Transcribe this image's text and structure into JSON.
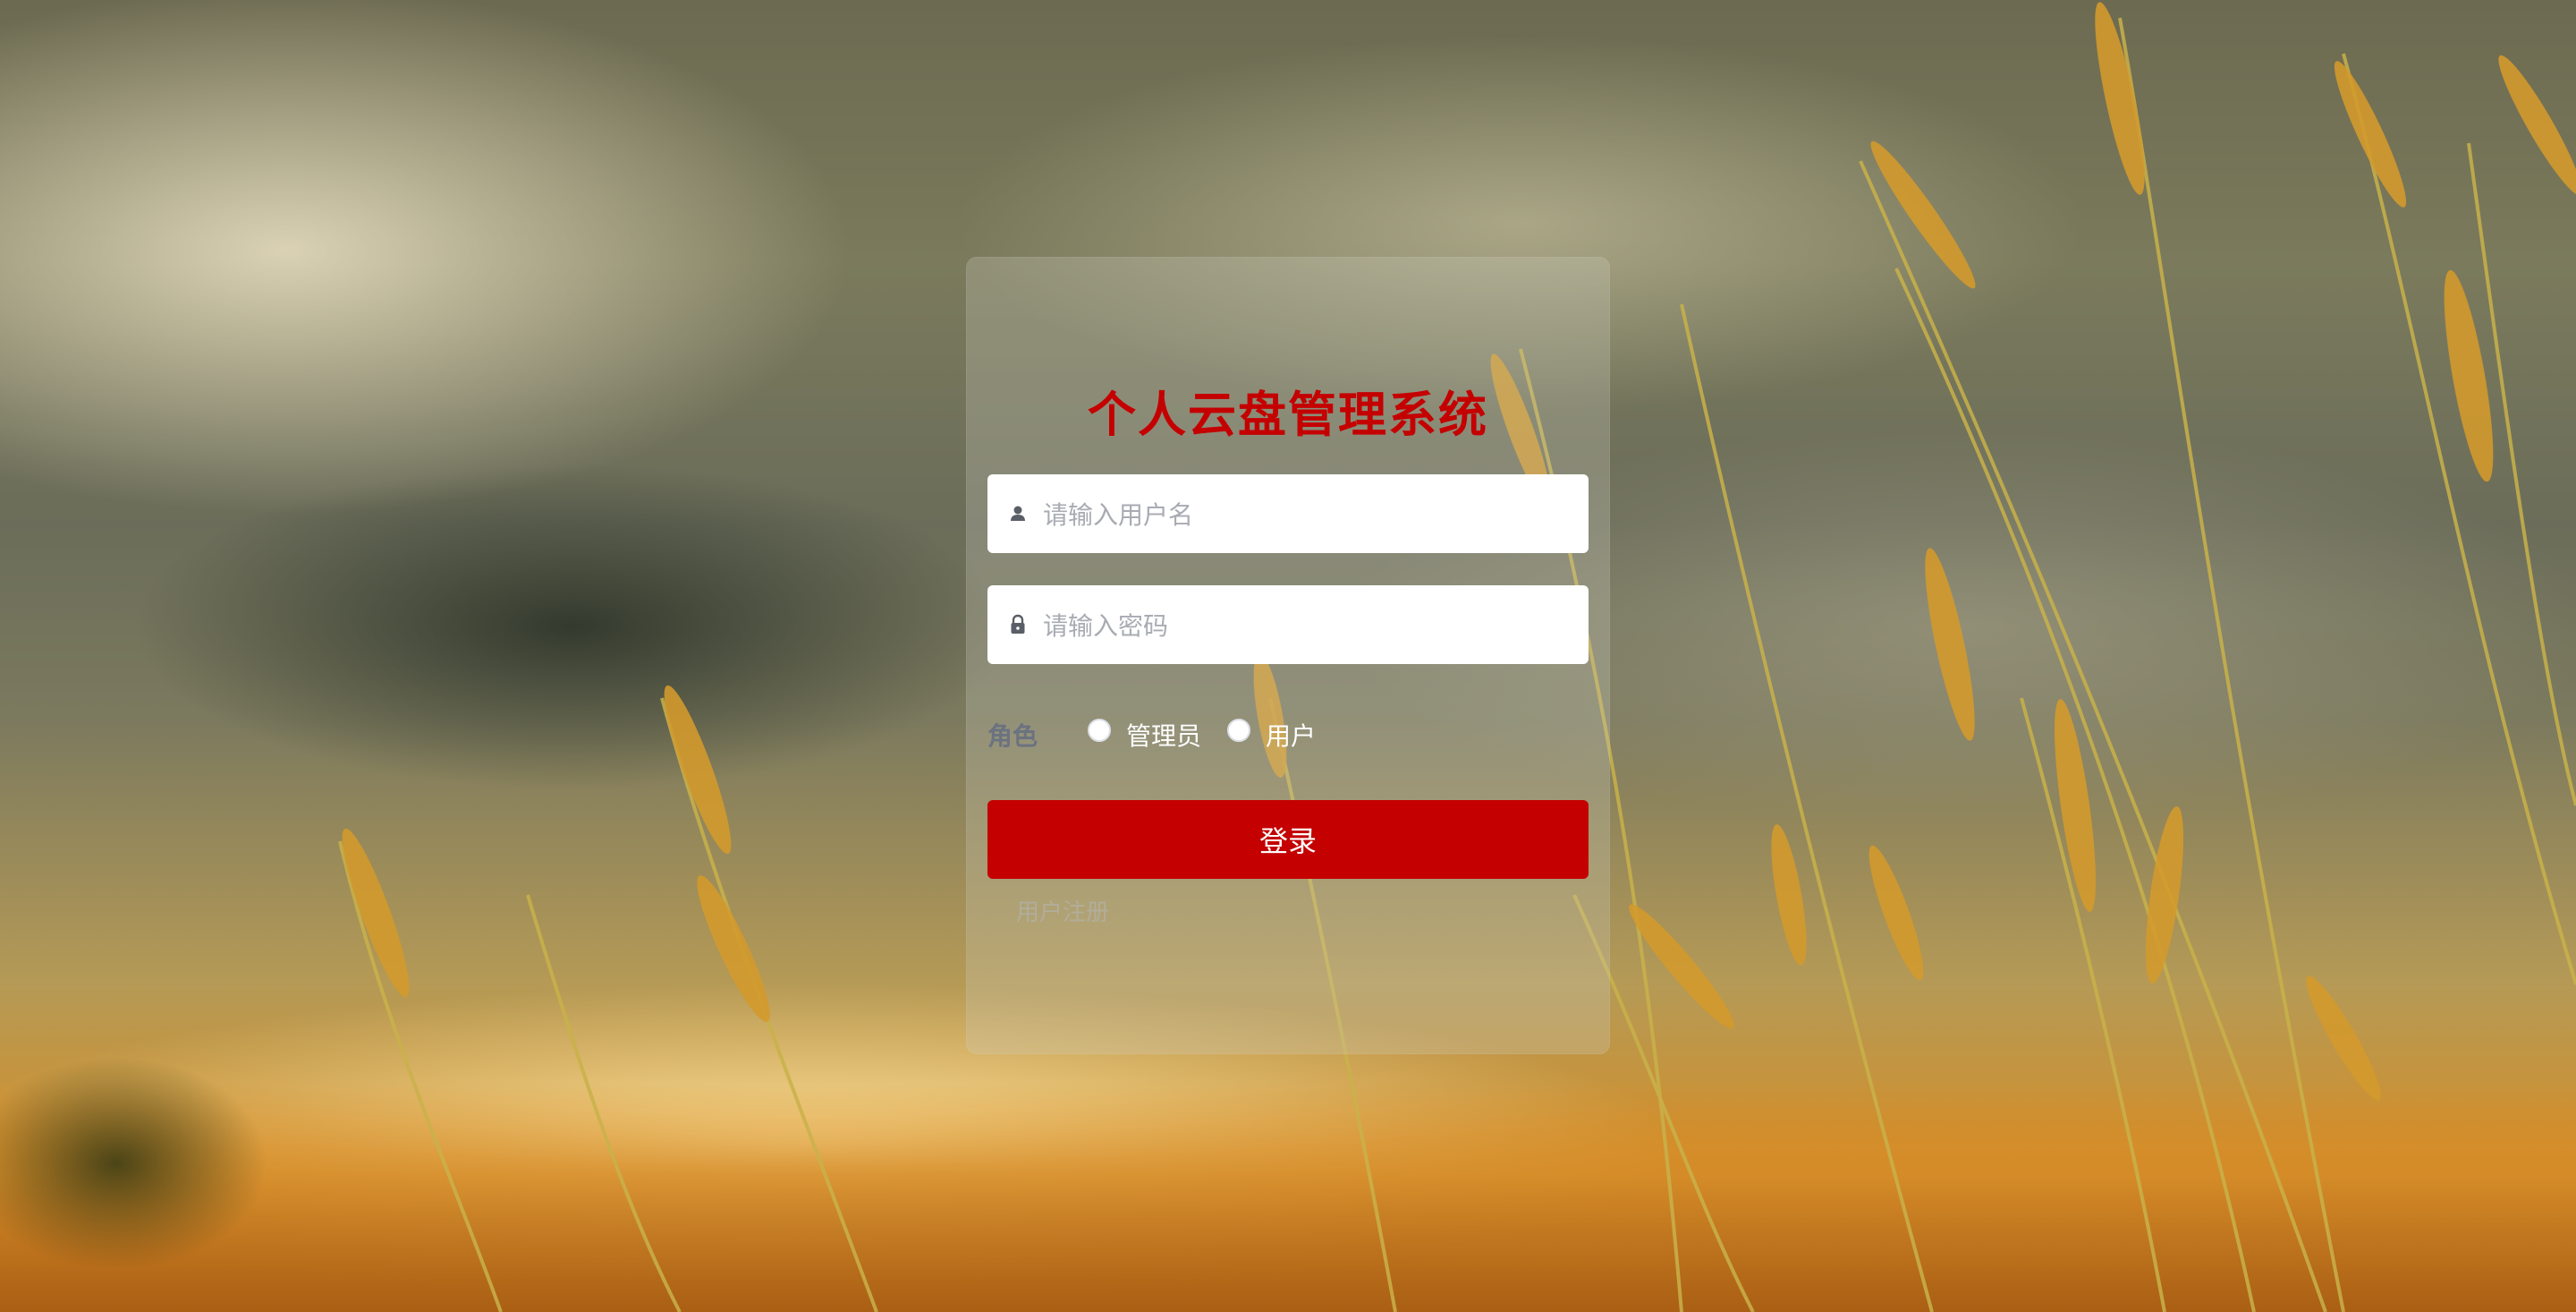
{
  "login": {
    "title": "个人云盘管理系统",
    "username_placeholder": "请输入用户名",
    "password_placeholder": "请输入密码",
    "role_label": "角色",
    "roles": [
      {
        "label": "管理员",
        "selected": false
      },
      {
        "label": "用户",
        "selected": false
      }
    ],
    "login_button": "登录",
    "register_link": "用户注册"
  },
  "icons": {
    "username": "user-icon",
    "password": "lock-icon"
  },
  "colors": {
    "accent": "#c40000",
    "title": "#c40000",
    "placeholder": "#a8abb2",
    "role_label": "#6b7280"
  }
}
